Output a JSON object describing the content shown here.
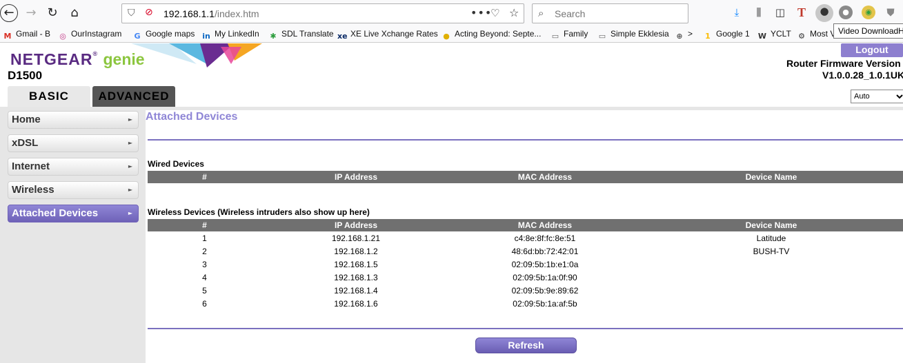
{
  "browser": {
    "url_host": "192.168.1.1",
    "url_path": "/index.htm",
    "search_placeholder": "Search",
    "tooltip": "Video DownloadHelper"
  },
  "bookmarks": [
    {
      "label": "Gmail - B",
      "icon": "gmail-icon",
      "glyph": "M",
      "color": "#d93025"
    },
    {
      "label": "OurInstagram",
      "icon": "instagram-icon",
      "glyph": "◎",
      "color": "#c13584"
    },
    {
      "label": "Google maps",
      "icon": "google-icon",
      "glyph": "G",
      "color": "#4285f4"
    },
    {
      "label": "My LinkedIn",
      "icon": "linkedin-icon",
      "glyph": "in",
      "color": "#0a66c2"
    },
    {
      "label": "SDL Translate",
      "icon": "sdl-icon",
      "glyph": "✱",
      "color": "#2e9e3e"
    },
    {
      "label": "XE Live Xchange Rates",
      "icon": "xe-icon",
      "glyph": "xe",
      "color": "#0a2a66"
    },
    {
      "label": "Acting Beyond: Septe...",
      "icon": "acting-icon",
      "glyph": "●",
      "color": "#e0b000"
    },
    {
      "label": "Family",
      "icon": "folder-icon",
      "glyph": "▭",
      "color": "#666"
    },
    {
      "label": "Simple Ekklesia",
      "icon": "folder-icon",
      "glyph": "▭",
      "color": "#666"
    },
    {
      "label": ">",
      "icon": "globe-icon",
      "glyph": "⊕",
      "color": "#555"
    },
    {
      "label": "Google 1",
      "icon": "google1-icon",
      "glyph": "1",
      "color": "#fbbc04"
    },
    {
      "label": "YCLT",
      "icon": "yclt-icon",
      "glyph": "W",
      "color": "#333"
    },
    {
      "label": "Most V",
      "icon": "gear-icon",
      "glyph": "⚙",
      "color": "#333"
    }
  ],
  "router": {
    "brand": "NETGEAR",
    "brand_suffix": "genie",
    "reg_mark": "®",
    "model": "D1500",
    "logout_label": "Logout",
    "firmware_label": "Router Firmware Version",
    "firmware_version": "V1.0.0.28_1.0.1UK",
    "tabs": {
      "basic": "BASIC",
      "advanced": "ADVANCED"
    },
    "language_selected": "Auto"
  },
  "sidebar": {
    "items": [
      {
        "label": "Home"
      },
      {
        "label": "xDSL"
      },
      {
        "label": "Internet"
      },
      {
        "label": "Wireless"
      },
      {
        "label": "Attached Devices"
      }
    ],
    "arrow": "►"
  },
  "content": {
    "title": "Attached Devices",
    "wired_title": "Wired Devices",
    "wireless_title": "Wireless Devices (Wireless intruders also show up here)",
    "columns": [
      "#",
      "IP Address",
      "MAC Address",
      "Device Name"
    ],
    "wireless_devices": [
      {
        "num": "1",
        "ip": "192.168.1.21",
        "mac": "c4:8e:8f:fc:8e:51",
        "name": "Latitude"
      },
      {
        "num": "2",
        "ip": "192.168.1.2",
        "mac": "48:6d:bb:72:42:01",
        "name": "BUSH-TV"
      },
      {
        "num": "3",
        "ip": "192.168.1.5",
        "mac": "02:09:5b:1b:e1:0a",
        "name": ""
      },
      {
        "num": "4",
        "ip": "192.168.1.3",
        "mac": "02:09:5b:1a:0f:90",
        "name": ""
      },
      {
        "num": "5",
        "ip": "192.168.1.4",
        "mac": "02:09:5b:9e:89:62",
        "name": ""
      },
      {
        "num": "6",
        "ip": "192.168.1.6",
        "mac": "02:09:5b:1a:af:5b",
        "name": ""
      }
    ],
    "refresh_label": "Refresh"
  },
  "colors": {
    "accent": "#8f86d6",
    "brand_purple": "#5a2b82",
    "brand_green": "#8cc63f",
    "table_header": "#707070"
  }
}
